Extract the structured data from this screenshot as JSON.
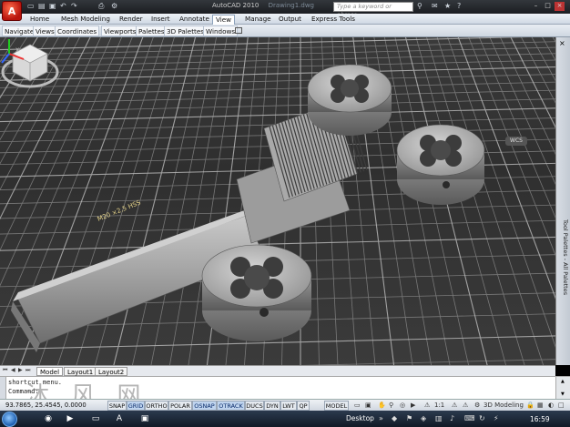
{
  "titlebar": {
    "app_title": "AutoCAD 2010",
    "document": "Drawing1.dwg",
    "search_placeholder": "Type a keyword or phrase",
    "logo_letter": "A",
    "qat_icons": [
      "new-icon",
      "open-icon",
      "save-icon",
      "undo-icon",
      "redo-icon",
      "plot-icon",
      "workspace-icon"
    ],
    "help_icons": [
      "binoculars-icon",
      "communication-center-icon",
      "favorites-icon",
      "help-icon"
    ]
  },
  "ribbon": {
    "tabs": [
      "Home",
      "Mesh Modeling",
      "Render",
      "Insert",
      "Annotate",
      "View",
      "Manage",
      "Output",
      "Express Tools"
    ],
    "active_tab": "View",
    "panels": [
      "Navigate",
      "Views",
      "Coordinates",
      "Viewports",
      "Palettes",
      "3D Palettes",
      "Windows"
    ]
  },
  "viewport": {
    "background": "#333333",
    "grid_color": "#8e8e8e",
    "model_color": "#a7a7a7",
    "engraving": "M20 ×2.5 HSS",
    "viewcube_label": "WCS"
  },
  "tool_palette": {
    "label": "Tool Palettes - All Palettes",
    "close": "×"
  },
  "layout_tabs": {
    "tabs": [
      "Model",
      "Layout1",
      "Layout2"
    ],
    "active": "Model"
  },
  "command": {
    "lines": [
      "shortcut menu.",
      "Command:"
    ]
  },
  "statusbar": {
    "coordinates": "93.7865, 25.4545, 0.0000",
    "toggles": [
      "SNAP",
      "GRID",
      "ORTHO",
      "POLAR",
      "OSNAP",
      "OTRACK",
      "DUCS",
      "DYN",
      "LWT",
      "QP"
    ],
    "active_toggles": [
      "GRID",
      "OSNAP",
      "OTRACK"
    ],
    "model_label": "MODEL",
    "scale": "1:1",
    "workspace": "3D Modeling"
  },
  "taskbar": {
    "desktop_label": "Desktop",
    "clock": "16:59"
  },
  "watermark": "沐 风 网"
}
